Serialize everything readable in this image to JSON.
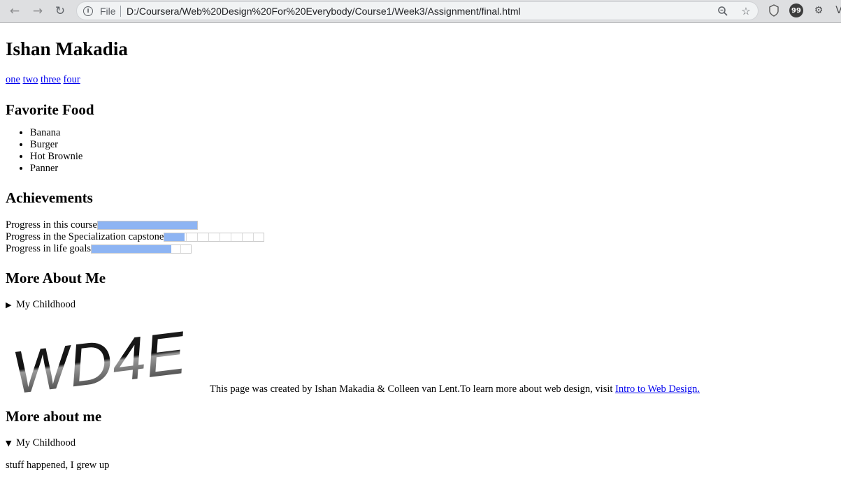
{
  "browser": {
    "file_label": "File",
    "url": "D:/Coursera/Web%20Design%20For%20Everybody/Course1/Week3/Assignment/final.html",
    "icons": [
      "back-arrow-icon",
      "forward-arrow-icon",
      "reload-icon",
      "info-icon",
      "zoom-icon",
      "star-icon",
      "shield-extension-icon",
      "chat-extension-icon",
      "gear-extension-icon",
      "profile-icon"
    ]
  },
  "page": {
    "title": "Ishan Makadia",
    "nav_links": [
      "one",
      "two",
      "three",
      "four"
    ],
    "food": {
      "heading": "Favorite Food",
      "items": [
        "Banana",
        "Burger",
        "Hot Brownie",
        "Panner"
      ]
    },
    "achievements": {
      "heading": "Achievements",
      "rows": [
        {
          "label": "Progress in this course",
          "value": 1.0
        },
        {
          "label": "Progress in the Specialization capstone",
          "value": 0.2
        },
        {
          "label": "Progress in life goals",
          "value": 0.8
        }
      ],
      "fill_color": "#8db4f3"
    },
    "more": {
      "heading": "More About Me",
      "summary": "My Childhood",
      "logo_text": "WD4E",
      "credit_text": "This page was created by Ishan Makadia & Colleen van Lent.To learn more about web design, visit ",
      "credit_link": "Intro to Web Design."
    },
    "more2": {
      "heading": "More about me",
      "summary": "My Childhood",
      "body": "stuff happened, I grew up"
    }
  }
}
